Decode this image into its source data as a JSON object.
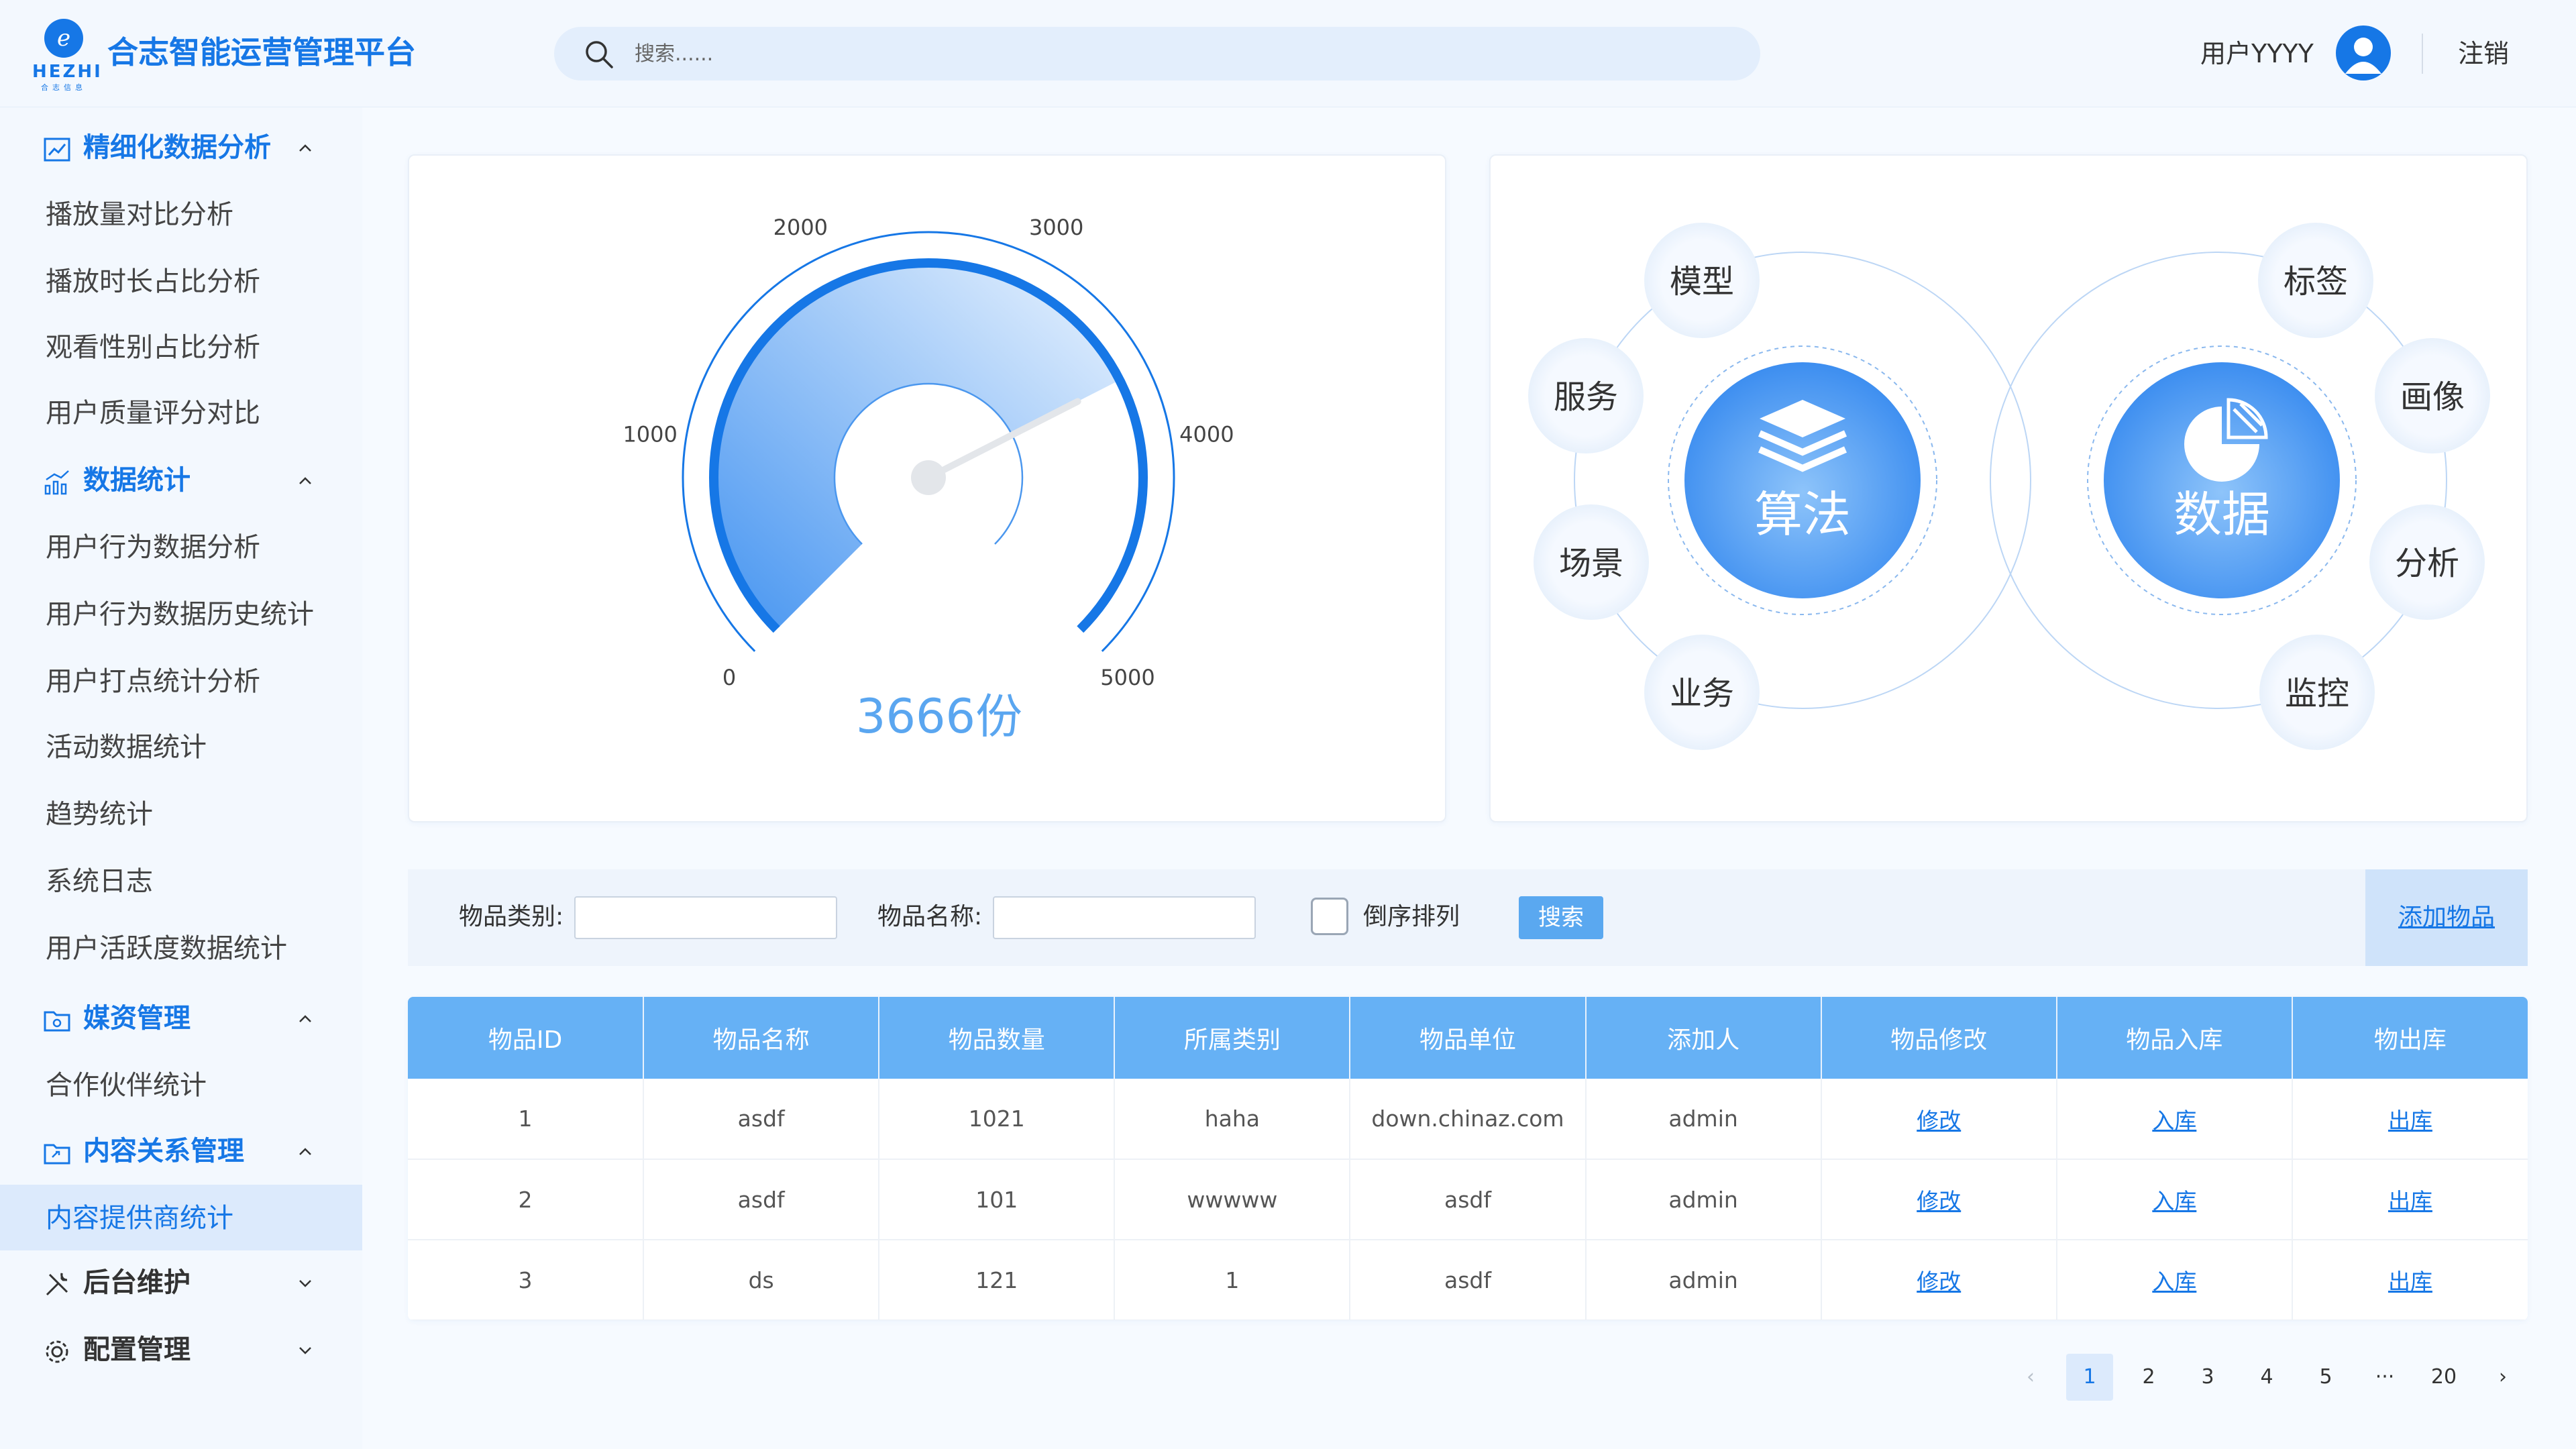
{
  "header": {
    "logo_mark": "e",
    "logo_word": "HEZHI",
    "logo_sub": "合志信息",
    "app_title": "合志智能运营管理平台",
    "search_placeholder": "搜索......",
    "user_name": "用户YYYY",
    "logout": "注销"
  },
  "sidebar": {
    "groups": [
      {
        "label": "精细化数据分析",
        "icon": "trend-chart-icon",
        "state": "open",
        "items": [
          "播放量对比分析",
          "播放时长占比分析",
          "观看性别占比分析",
          "用户质量评分对比"
        ]
      },
      {
        "label": "数据统计",
        "icon": "bar-chart-icon",
        "state": "open",
        "items": [
          "用户行为数据分析",
          "用户行为数据历史统计",
          "用户打点统计分析",
          "活动数据统计",
          "趋势统计",
          "系统日志",
          "用户活跃度数据统计"
        ]
      },
      {
        "label": "媒资管理",
        "icon": "folder-icon",
        "state": "open",
        "items": [
          "合作伙伴统计"
        ]
      },
      {
        "label": "内容关系管理",
        "icon": "link-folder-icon",
        "state": "open",
        "items": [
          "内容提供商统计"
        ]
      },
      {
        "label": "后台维护",
        "icon": "tools-icon",
        "state": "closed",
        "items": []
      },
      {
        "label": "配置管理",
        "icon": "gear-icon",
        "state": "closed",
        "items": []
      }
    ],
    "active_item": "内容提供商统计"
  },
  "gauge": {
    "value": 3666,
    "max": 5000,
    "value_label": "3666份",
    "ticks": [
      "0",
      "1000",
      "2000",
      "3000",
      "4000",
      "5000"
    ],
    "accent": "#1677e6"
  },
  "relation": {
    "left_center": "算法",
    "right_center": "数据",
    "left_nodes": [
      "模型",
      "服务",
      "场景",
      "业务"
    ],
    "right_nodes": [
      "标签",
      "画像",
      "分析",
      "监控"
    ]
  },
  "filter": {
    "category_label": "物品类别:",
    "name_label": "物品名称:",
    "sort_label": "倒序排列",
    "search_button": "搜索",
    "add_button": "添加物品"
  },
  "table": {
    "columns": [
      "物品ID",
      "物品名称",
      "物品数量",
      "所属类别",
      "物品单位",
      "添加人",
      "物品修改",
      "物品入库",
      "物出库"
    ],
    "rows": [
      [
        "1",
        "asdf",
        "1021",
        "haha",
        "down.chinaz.com",
        "admin",
        "修改",
        "入库",
        "出库"
      ],
      [
        "2",
        "asdf",
        "101",
        "wwwww",
        "asdf",
        "admin",
        "修改",
        "入库",
        "出库"
      ],
      [
        "3",
        "ds",
        "121",
        "1",
        "asdf",
        "admin",
        "修改",
        "入库",
        "出库"
      ]
    ]
  },
  "pagination": {
    "prev": "‹",
    "pages": [
      "1",
      "2",
      "3",
      "4",
      "5",
      "···",
      "20"
    ],
    "next": "›",
    "current": "1"
  }
}
